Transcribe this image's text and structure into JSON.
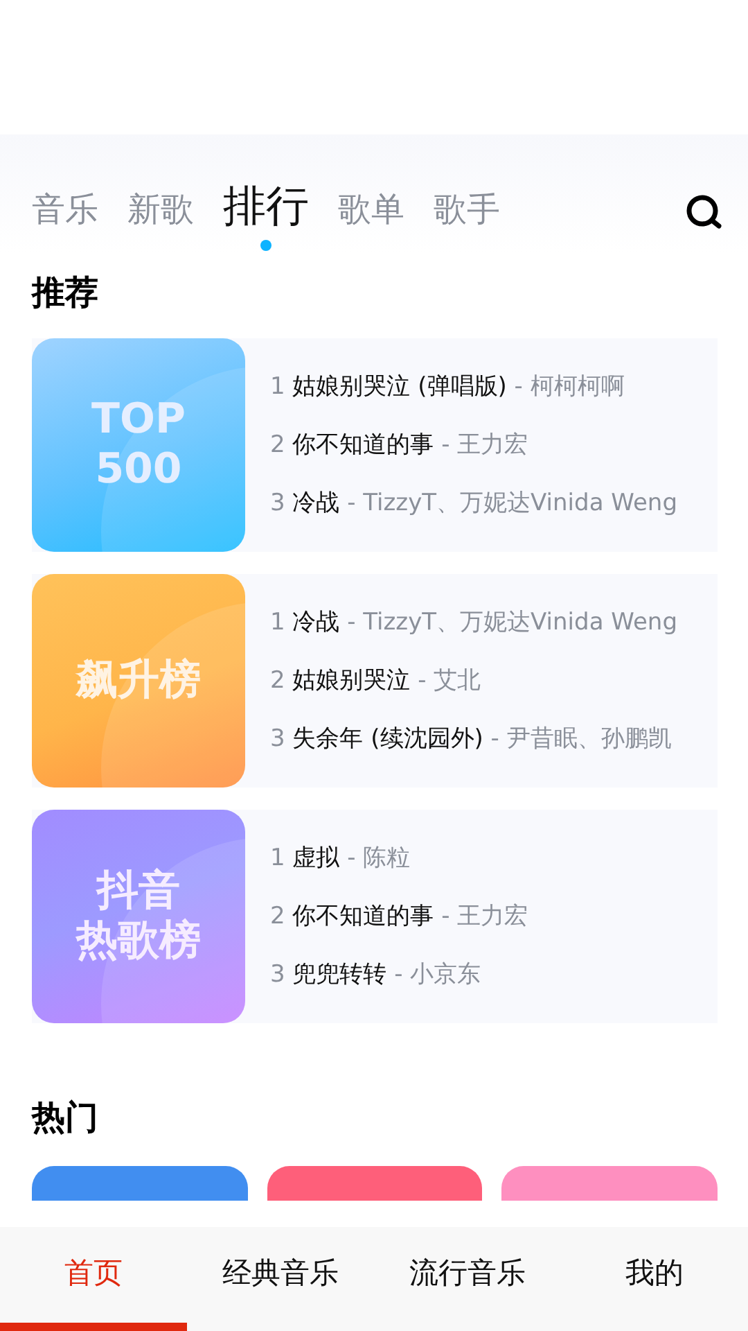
{
  "top_tabs": [
    {
      "label": "音乐",
      "selected": false
    },
    {
      "label": "新歌",
      "selected": false
    },
    {
      "label": "排行",
      "selected": true
    },
    {
      "label": "歌单",
      "selected": false
    },
    {
      "label": "歌手",
      "selected": false
    }
  ],
  "recommend": {
    "heading": "推荐",
    "charts": [
      {
        "kind": "blue",
        "cover_lines": [
          "TOP",
          "500"
        ],
        "songs": [
          {
            "rank": "1",
            "title": "姑娘别哭泣 (弹唱版)",
            "artist": "- 柯柯柯啊"
          },
          {
            "rank": "2",
            "title": "你不知道的事",
            "artist": "- 王力宏"
          },
          {
            "rank": "3",
            "title": "冷战",
            "artist": "- TizzyT、万妮达Vinida Weng"
          }
        ]
      },
      {
        "kind": "orange",
        "cover_lines": [
          "飙升榜"
        ],
        "songs": [
          {
            "rank": "1",
            "title": "冷战",
            "artist": "- TizzyT、万妮达Vinida Weng"
          },
          {
            "rank": "2",
            "title": "姑娘别哭泣",
            "artist": "- 艾北"
          },
          {
            "rank": "3",
            "title": "失余年 (续沈园外)",
            "artist": "- 尹昔眠、孙鹏凯"
          }
        ]
      },
      {
        "kind": "purple",
        "cover_lines": [
          "抖音",
          "热歌榜"
        ],
        "songs": [
          {
            "rank": "1",
            "title": "虚拟",
            "artist": "- 陈粒"
          },
          {
            "rank": "2",
            "title": "你不知道的事",
            "artist": "- 王力宏"
          },
          {
            "rank": "3",
            "title": "兜兜转转",
            "artist": "- 小京东"
          }
        ]
      }
    ]
  },
  "hot": {
    "heading": "热门",
    "cards": [
      {
        "color": "#418ef0"
      },
      {
        "color": "#fe5f7a"
      },
      {
        "color": "#fe8fbf"
      }
    ]
  },
  "bottom_nav": [
    {
      "label": "首页",
      "selected": true
    },
    {
      "label": "经典音乐",
      "selected": false
    },
    {
      "label": "流行音乐",
      "selected": false
    },
    {
      "label": "我的",
      "selected": false
    }
  ]
}
